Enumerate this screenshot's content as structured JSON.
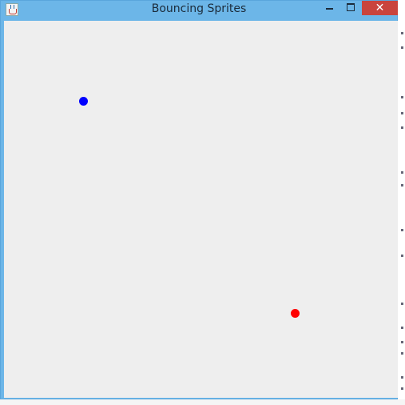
{
  "window": {
    "title": "Bouncing Sprites",
    "close_glyph": "✕",
    "app_icon": "java-cup-icon",
    "minimize_icon": "minimize-icon",
    "maximize_icon": "maximize-icon",
    "frame_color": "#6cb6e8",
    "close_color": "#c9443d"
  },
  "canvas": {
    "background": "#eeeeee",
    "sprites": [
      {
        "name": "blue-sprite",
        "color": "#0000ff"
      },
      {
        "name": "red-sprite",
        "color": "#ff0000"
      }
    ]
  }
}
